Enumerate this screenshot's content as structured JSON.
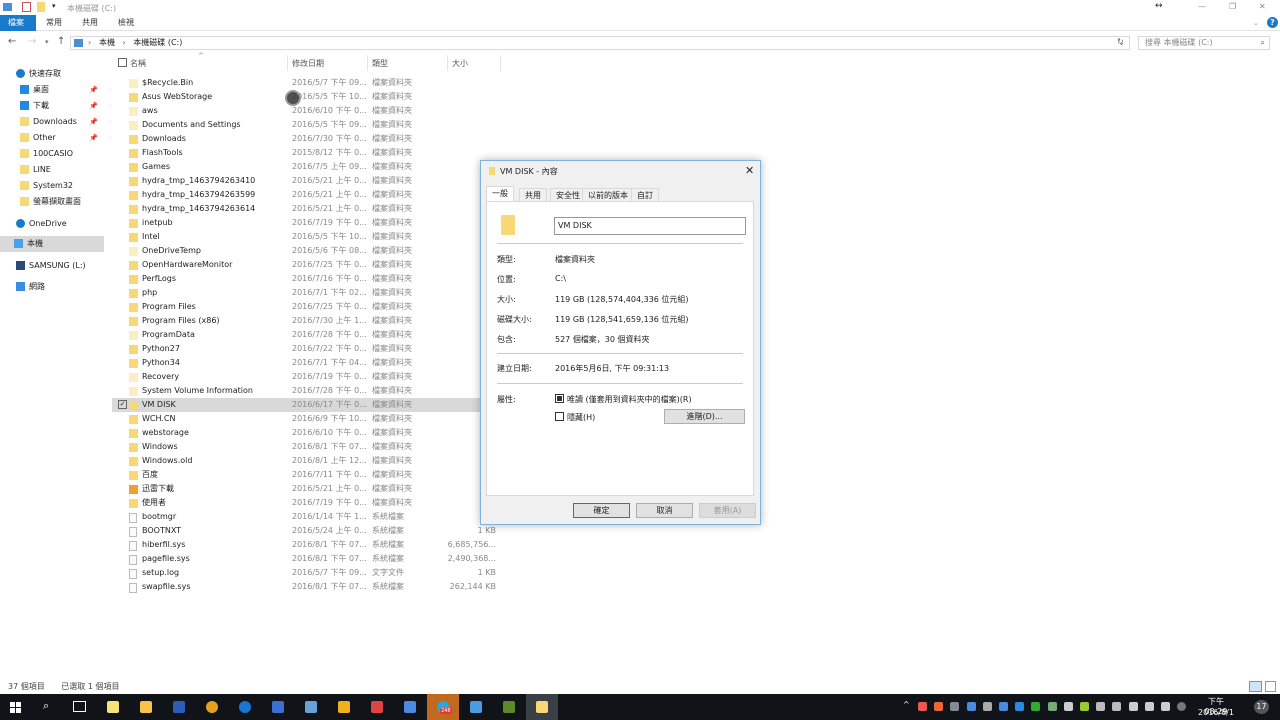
{
  "window": {
    "title": "本機磁碟 (C:)",
    "minimize": "—",
    "maximize": "❐",
    "close": "✕",
    "help": "?"
  },
  "ribbon": {
    "tabs": [
      "檔案",
      "常用",
      "共用",
      "檢視"
    ]
  },
  "address": {
    "crumbs": [
      "本機",
      "本機磁碟 (C:)"
    ],
    "search_placeholder": "搜尋 本機磁碟 (C:)"
  },
  "sidebar": {
    "items": [
      {
        "label": "快速存取",
        "icon": "star-icon"
      },
      {
        "label": "桌面",
        "icon": "desktop-icon",
        "pinned": true
      },
      {
        "label": "下載",
        "icon": "download-icon",
        "pinned": true
      },
      {
        "label": "Downloads",
        "icon": "folder-icon",
        "pinned": true
      },
      {
        "label": "Other",
        "icon": "folder-icon",
        "pinned": true
      },
      {
        "label": "100CASIO",
        "icon": "folder-icon"
      },
      {
        "label": "LINE",
        "icon": "folder-icon"
      },
      {
        "label": "System32",
        "icon": "folder-icon"
      },
      {
        "label": "螢幕擷取畫面",
        "icon": "folder-icon"
      },
      {
        "label": "OneDrive",
        "icon": "cloud-icon"
      },
      {
        "label": "本機",
        "icon": "computer-icon",
        "selected": true
      },
      {
        "label": "SAMSUNG (L:)",
        "icon": "drive-icon"
      },
      {
        "label": "網路",
        "icon": "network-icon"
      }
    ]
  },
  "columns": {
    "name": "名稱",
    "date": "修改日期",
    "type": "類型",
    "size": "大小"
  },
  "files": [
    {
      "name": "$Recycle.Bin",
      "date": "2016/5/7 下午 09...",
      "type": "檔案資料夾",
      "size": "",
      "kind": "hidden"
    },
    {
      "name": "Asus WebStorage",
      "date": "2016/5/5 下午 10...",
      "type": "檔案資料夾",
      "size": "",
      "kind": "folder"
    },
    {
      "name": "aws",
      "date": "2016/6/10 下午 0...",
      "type": "檔案資料夾",
      "size": "",
      "kind": "hidden"
    },
    {
      "name": "Documents and Settings",
      "date": "2016/5/5 下午 09...",
      "type": "檔案資料夾",
      "size": "",
      "kind": "link"
    },
    {
      "name": "Downloads",
      "date": "2016/7/30 下午 0...",
      "type": "檔案資料夾",
      "size": "",
      "kind": "folder"
    },
    {
      "name": "FlashTools",
      "date": "2015/8/12 下午 0...",
      "type": "檔案資料夾",
      "size": "",
      "kind": "folder"
    },
    {
      "name": "Games",
      "date": "2016/7/5 上午 09...",
      "type": "檔案資料夾",
      "size": "",
      "kind": "folder"
    },
    {
      "name": "hydra_tmp_1463794263410",
      "date": "2016/5/21 上午 0...",
      "type": "檔案資料夾",
      "size": "",
      "kind": "folder"
    },
    {
      "name": "hydra_tmp_1463794263599",
      "date": "2016/5/21 上午 0...",
      "type": "檔案資料夾",
      "size": "",
      "kind": "folder"
    },
    {
      "name": "hydra_tmp_1463794263614",
      "date": "2016/5/21 上午 0...",
      "type": "檔案資料夾",
      "size": "",
      "kind": "folder"
    },
    {
      "name": "inetpub",
      "date": "2016/7/19 下午 0...",
      "type": "檔案資料夾",
      "size": "",
      "kind": "folder"
    },
    {
      "name": "Intel",
      "date": "2016/5/5 下午 10...",
      "type": "檔案資料夾",
      "size": "",
      "kind": "folder"
    },
    {
      "name": "OneDriveTemp",
      "date": "2016/5/6 下午 08...",
      "type": "檔案資料夾",
      "size": "",
      "kind": "hidden"
    },
    {
      "name": "OpenHardwareMonitor",
      "date": "2016/7/25 下午 0...",
      "type": "檔案資料夾",
      "size": "",
      "kind": "folder"
    },
    {
      "name": "PerfLogs",
      "date": "2016/7/16 下午 0...",
      "type": "檔案資料夾",
      "size": "",
      "kind": "folder"
    },
    {
      "name": "php",
      "date": "2016/7/1 下午 02...",
      "type": "檔案資料夾",
      "size": "",
      "kind": "folder"
    },
    {
      "name": "Program Files",
      "date": "2016/7/25 下午 0...",
      "type": "檔案資料夾",
      "size": "",
      "kind": "folder"
    },
    {
      "name": "Program Files (x86)",
      "date": "2016/7/30 上午 1...",
      "type": "檔案資料夾",
      "size": "",
      "kind": "folder"
    },
    {
      "name": "ProgramData",
      "date": "2016/7/28 下午 0...",
      "type": "檔案資料夾",
      "size": "",
      "kind": "hidden"
    },
    {
      "name": "Python27",
      "date": "2016/7/22 下午 0...",
      "type": "檔案資料夾",
      "size": "",
      "kind": "folder"
    },
    {
      "name": "Python34",
      "date": "2016/7/1 下午 04...",
      "type": "檔案資料夾",
      "size": "",
      "kind": "folder"
    },
    {
      "name": "Recovery",
      "date": "2016/7/19 下午 0...",
      "type": "檔案資料夾",
      "size": "",
      "kind": "hidden"
    },
    {
      "name": "System Volume Information",
      "date": "2016/7/28 下午 0...",
      "type": "檔案資料夾",
      "size": "",
      "kind": "hidden"
    },
    {
      "name": "VM DISK",
      "date": "2016/6/17 下午 0...",
      "type": "檔案資料夾",
      "size": "",
      "kind": "folder",
      "selected": true
    },
    {
      "name": "WCH.CN",
      "date": "2016/6/9 下午 10...",
      "type": "檔案資料夾",
      "size": "",
      "kind": "folder"
    },
    {
      "name": "webstorage",
      "date": "2016/6/10 下午 0...",
      "type": "檔案資料夾",
      "size": "",
      "kind": "folder"
    },
    {
      "name": "Windows",
      "date": "2016/8/1 下午 07...",
      "type": "檔案資料夾",
      "size": "",
      "kind": "folder"
    },
    {
      "name": "Windows.old",
      "date": "2016/8/1 上午 12...",
      "type": "檔案資料夾",
      "size": "",
      "kind": "folder"
    },
    {
      "name": "百度",
      "date": "2016/7/11 下午 0...",
      "type": "檔案資料夾",
      "size": "",
      "kind": "folder"
    },
    {
      "name": "迅雷下載",
      "date": "2016/5/21 上午 0...",
      "type": "檔案資料夾",
      "size": "",
      "kind": "special"
    },
    {
      "name": "使用者",
      "date": "2016/7/19 下午 0...",
      "type": "檔案資料夾",
      "size": "",
      "kind": "folder"
    },
    {
      "name": "bootmgr",
      "date": "2016/1/14 下午 1...",
      "type": "系統檔案",
      "size": "39",
      "kind": "file"
    },
    {
      "name": "BOOTNXT",
      "date": "2016/5/24 上午 0...",
      "type": "系統檔案",
      "size": "1 KB",
      "kind": "file"
    },
    {
      "name": "hiberfil.sys",
      "date": "2016/8/1 下午 07...",
      "type": "系統檔案",
      "size": "6,685,756...",
      "kind": "file"
    },
    {
      "name": "pagefile.sys",
      "date": "2016/8/1 下午 07...",
      "type": "系統檔案",
      "size": "2,490,368...",
      "kind": "file"
    },
    {
      "name": "setup.log",
      "date": "2016/5/7 下午 09...",
      "type": "文字文件",
      "size": "1 KB",
      "kind": "text"
    },
    {
      "name": "swapfile.sys",
      "date": "2016/8/1 下午 07...",
      "type": "系統檔案",
      "size": "262,144 KB",
      "kind": "file"
    }
  ],
  "status": {
    "count": "37 個項目",
    "selected": "已選取 1 個項目"
  },
  "dialog": {
    "title": "VM DISK - 內容",
    "tabs": [
      "一般",
      "共用",
      "安全性",
      "以前的版本",
      "自訂"
    ],
    "name_value": "VM DISK",
    "rows": [
      {
        "label": "類型:",
        "value": "檔案資料夾"
      },
      {
        "label": "位置:",
        "value": "C:\\"
      },
      {
        "label": "大小:",
        "value": "119 GB (128,574,404,336 位元組)"
      },
      {
        "label": "磁碟大小:",
        "value": "119 GB (128,541,659,136 位元組)"
      },
      {
        "label": "包含:",
        "value": "527 個檔案，30 個資料夾"
      }
    ],
    "created_label": "建立日期:",
    "created_value": "2016年5月6日, 下午 09:31:13",
    "attr_label": "屬性:",
    "readonly_label": "唯讀 (僅套用到資料夾中的檔案)(R)",
    "hidden_label": "隱藏(H)",
    "advanced_label": "進階(D)...",
    "ok": "確定",
    "cancel": "取消",
    "apply": "套用(A)"
  },
  "taskbar": {
    "time": "下午 08:29",
    "date": "2016/8/1",
    "notifications": "17",
    "badge": "248"
  }
}
